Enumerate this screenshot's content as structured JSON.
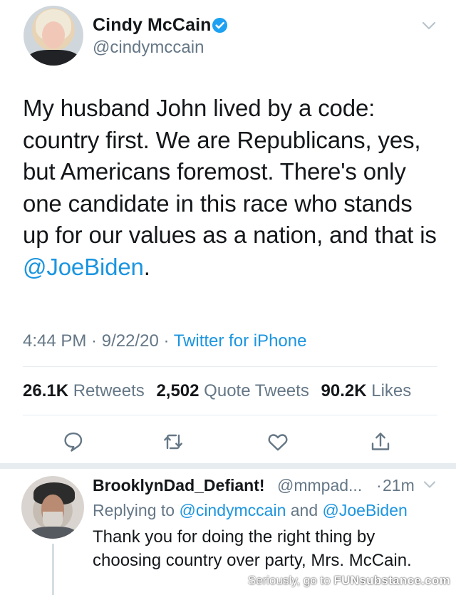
{
  "tweet": {
    "author_name": "Cindy McCain",
    "author_handle": "@cindymccain",
    "verified_icon": "verified-badge-icon",
    "text_parts": [
      "My husband John lived by a code: country first. We are Republicans, yes, but Americans foremost. There's only one candidate in this race who stands up for our values as a nation, and that is ",
      "@JoeBiden",
      "."
    ],
    "time": "4:44 PM",
    "date": "9/22/20",
    "separator": " · ",
    "source": "Twitter for iPhone",
    "stats": {
      "retweets_count": "26.1K",
      "retweets_label": "Retweets",
      "quote_count": "2,502",
      "quote_label": "Quote Tweets",
      "likes_count": "90.2K",
      "likes_label": "Likes"
    },
    "actions": [
      "reply-icon",
      "retweet-icon",
      "like-icon",
      "share-icon"
    ]
  },
  "reply": {
    "author_name": "BrooklynDad_Defiant!",
    "author_handle": "@mmpad...",
    "dot": "·",
    "time": "21m",
    "replying_label": "Replying to",
    "replying_to_1": "@cindymccain",
    "replying_and": "and",
    "replying_to_2": "@JoeBiden",
    "text": "Thank you for doing the right thing by choosing country over party, Mrs. McCain."
  },
  "watermark": {
    "prefix": "Seriously, go to",
    "brand_fun": "FUN",
    "brand_rest": "substance",
    "suffix": ".com"
  },
  "colors": {
    "link": "#1b95e0",
    "secondary": "#657786",
    "divider": "#e6ecf0"
  }
}
